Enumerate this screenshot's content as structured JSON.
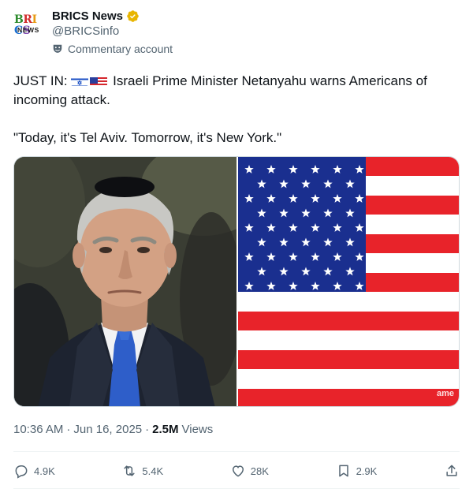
{
  "author": {
    "display_name": "BRICS News",
    "handle": "@BRICSinfo",
    "verified_color": "#e8b500",
    "account_label": "Commentary account",
    "avatar_logo_top": [
      "B",
      "R",
      "I",
      "C",
      "S"
    ],
    "avatar_logo_top_colors": [
      "#2e8b2e",
      "#d12b2b",
      "#e79a14",
      "#1a6fd1",
      "#7a3fb0"
    ],
    "avatar_logo_bottom": "NEWS"
  },
  "post": {
    "line1_prefix": "JUST IN:",
    "line1_text": "Israeli Prime Minister Netanyahu warns Americans of incoming attack.",
    "line2": "\"Today, it's Tel Aviv. Tomorrow, it's New York.\"",
    "flag_icons": [
      "israel-flag-icon",
      "us-flag-icon"
    ]
  },
  "media": {
    "watermark": "ame"
  },
  "meta": {
    "time": "10:36 AM",
    "separator1": "·",
    "date": "Jun 16, 2025",
    "separator2": "·",
    "views_count": "2.5M",
    "views_label": "Views"
  },
  "actions": {
    "replies": "4.9K",
    "reposts": "5.4K",
    "likes": "28K",
    "bookmarks": "2.9K"
  },
  "colors": {
    "text": "#0f1419",
    "secondary": "#536471",
    "us_red": "#e8232a",
    "us_blue": "#1a2f8f"
  }
}
